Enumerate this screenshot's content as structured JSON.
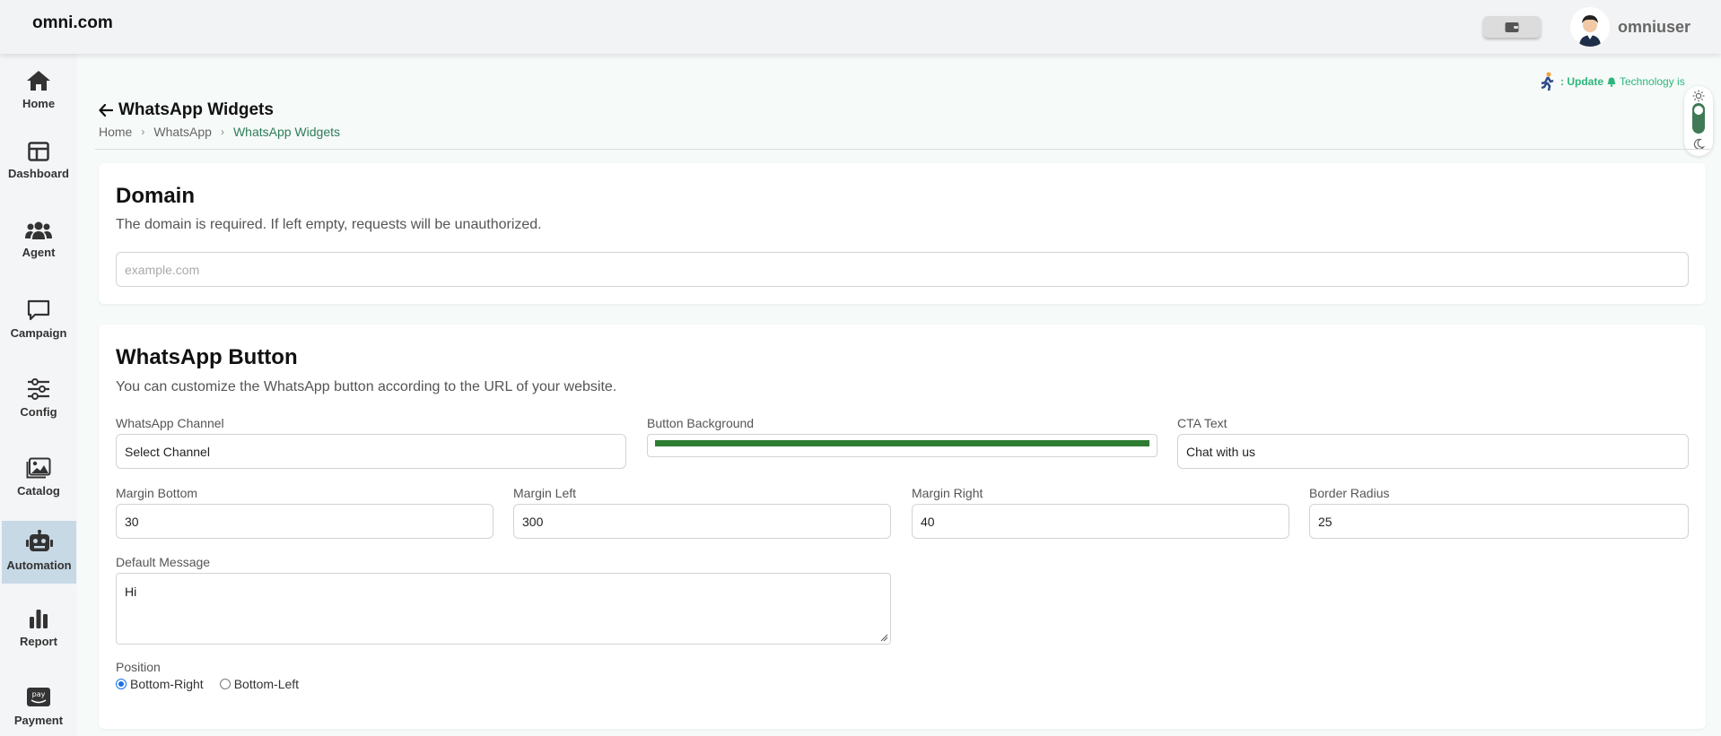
{
  "brand": "omni.com",
  "user": {
    "name": "omniuser"
  },
  "sidebar": {
    "items": [
      {
        "label": "Home",
        "icon": "home-icon"
      },
      {
        "label": "Dashboard",
        "icon": "dashboard-icon"
      },
      {
        "label": "Agent",
        "icon": "users-icon"
      },
      {
        "label": "Campaign",
        "icon": "chat-icon"
      },
      {
        "label": "Config",
        "icon": "sliders-icon"
      },
      {
        "label": "Catalog",
        "icon": "image-icon"
      },
      {
        "label": "Automation",
        "icon": "robot-icon",
        "active": true
      },
      {
        "label": "Report",
        "icon": "bar-chart-icon"
      },
      {
        "label": "Payment",
        "icon": "pay-icon"
      }
    ]
  },
  "ticker": {
    "prefix": ": Update",
    "text": "Technology is"
  },
  "page": {
    "title": "WhatsApp Widgets",
    "breadcrumb": [
      "Home",
      "WhatsApp",
      "WhatsApp Widgets"
    ]
  },
  "domain_card": {
    "title": "Domain",
    "description": "The domain is required. If left empty, requests will be unauthorized.",
    "placeholder": "example.com"
  },
  "button_card": {
    "title": "WhatsApp Button",
    "description": "You can customize the WhatsApp button according to the URL of your website.",
    "channel_label": "WhatsApp Channel",
    "channel_value": "Select Channel",
    "bg_label": "Button Background",
    "bg_color": "#2e7d32",
    "cta_label": "CTA Text",
    "cta_value": "Chat with us",
    "margin_bottom_label": "Margin Bottom",
    "margin_bottom_value": "30",
    "margin_left_label": "Margin Left",
    "margin_left_value": "300",
    "margin_right_label": "Margin Right",
    "margin_right_value": "40",
    "border_radius_label": "Border Radius",
    "border_radius_value": "25",
    "default_message_label": "Default Message",
    "default_message_value": "Hi",
    "position_label": "Position",
    "position_options": [
      "Bottom-Right",
      "Bottom-Left"
    ],
    "position_selected": "Bottom-Right"
  },
  "colors": {
    "accent": "#2e7d5b",
    "active_sidebar": "#c8d9e6",
    "ticker": "#2cb67d"
  }
}
